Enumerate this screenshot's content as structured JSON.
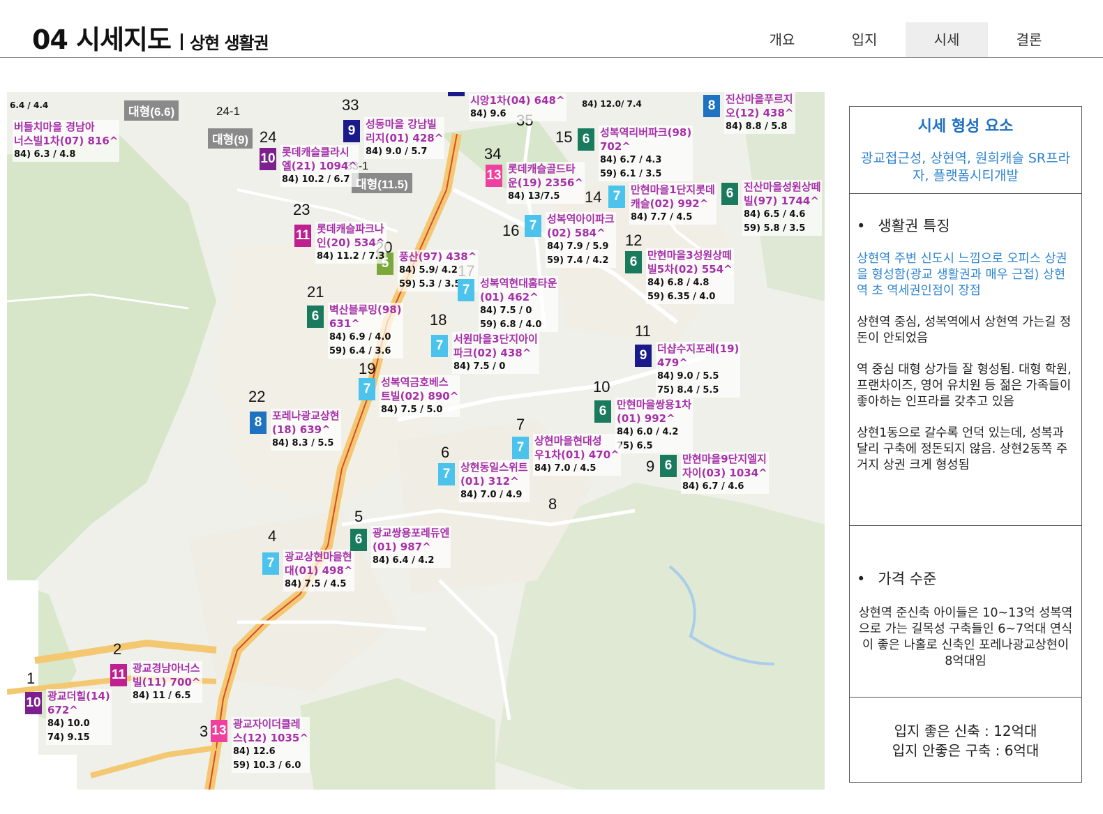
{
  "header": {
    "title": "04 시세지도",
    "subtitle": "상현 생활권",
    "tabs": [
      "개요",
      "입지",
      "시세",
      "결론"
    ],
    "active_tab": "시세"
  },
  "map": {
    "complexes": [
      {
        "badge": "10",
        "color": "#7c1f8f",
        "name1": "광교더힐(14)",
        "name2": "672^",
        "price1": "84) 10.0",
        "price2": "74) 9.15"
      },
      {
        "badge": "11",
        "color": "#c01f8f",
        "name1": "광교경남아너스",
        "name2": "빌(11) 700^",
        "price1": "84) 11 / 6.5",
        "price2": ""
      },
      {
        "badge": "13",
        "color": "#ef3f9f",
        "name1": "광교자이더클레",
        "name2": "스(12) 1035^",
        "price1": "84) 12.6",
        "price2": "59) 10.3 / 6.0"
      },
      {
        "badge": "7",
        "color": "#4cc3ec",
        "name1": "광교상현마을현",
        "name2": "대(01) 498^",
        "price1": "84) 7.5 / 4.5",
        "price2": ""
      },
      {
        "badge": "6",
        "color": "#1a7a5e",
        "name1": "광교쌍용포레듀엔",
        "name2": "(01) 987^",
        "price1": "84) 6.4 / 4.2",
        "price2": ""
      },
      {
        "badge": "7",
        "color": "#4cc3ec",
        "name1": "상현동일스위트",
        "name2": "(01) 312^",
        "price1": "84) 7.0 / 4.9",
        "price2": ""
      },
      {
        "badge": "8",
        "color": "#1d73c2",
        "name1": "포레나광교상현",
        "name2": "(18) 639^",
        "price1": "84) 8.3 / 5.5",
        "price2": ""
      },
      {
        "badge": "7",
        "color": "#4cc3ec",
        "name1": "성복역금호베스",
        "name2": "트빌(02) 890^",
        "price1": "84) 7.5 / 5.0",
        "price2": ""
      },
      {
        "badge": "7",
        "color": "#4cc3ec",
        "name1": "서원마을3단지아이",
        "name2": "파크(02) 438^",
        "price1": "84) 7.5 / 0",
        "price2": ""
      },
      {
        "badge": "6",
        "color": "#1a7a5e",
        "name1": "벽산블루밍(98)",
        "name2": "631^",
        "price1": "84) 6.9 / 4.0",
        "price2": "59) 6.4 / 3.6"
      },
      {
        "badge": "5",
        "color": "#7aa83a",
        "name1": "풍산(97) 438^",
        "name2": "",
        "price1": "84) 5.9/ 4.2",
        "price2": "59) 5.3 / 3.5"
      },
      {
        "badge": "11",
        "color": "#c01f8f",
        "name1": "롯데캐슬파크나",
        "name2": "인(20) 534^",
        "price1": "84) 11.2 / 7.3",
        "price2": ""
      },
      {
        "badge": "10",
        "color": "#7c1f8f",
        "name1": "롯데캐슬클라시",
        "name2": "엘(21) 1094^",
        "price1": "84) 10.2 / 6.7",
        "price2": ""
      },
      {
        "badge": "9",
        "color": "#1a1a8a",
        "name1": "성동마을 강남빌",
        "name2": "리지(01) 428^",
        "price1": "84) 9.0 / 5.7",
        "price2": ""
      },
      {
        "badge": "13",
        "color": "#ef3f9f",
        "name1": "롯데캐슬골드타",
        "name2": "운(19) 2356^",
        "price1": "84) 13/7.5",
        "price2": ""
      },
      {
        "badge": "7",
        "color": "#4cc3ec",
        "name1": "성복역아이파크",
        "name2": "(02) 584^",
        "price1": "84) 7.9 / 5.9",
        "price2": "59) 7.4 / 4.2"
      },
      {
        "badge": "7",
        "color": "#4cc3ec",
        "name1": "성복역현대홈타운",
        "name2": "(01) 462^",
        "price1": "84) 7.5 / 0",
        "price2": "59) 6.8 / 4.0"
      },
      {
        "badge": "6",
        "color": "#1a7a5e",
        "name1": "성복역리버파크(98)",
        "name2": "702^",
        "price1": "84) 6.7 / 4.3",
        "price2": "59) 6.1 / 3.5"
      },
      {
        "badge": "7",
        "color": "#4cc3ec",
        "name1": "만현마을1단지롯데",
        "name2": "캐슬(02) 992^",
        "price1": "84) 7.7 / 4.5",
        "price2": ""
      },
      {
        "badge": "6",
        "color": "#1a7a5e",
        "name1": "만현마을3성원상떼",
        "name2": "빌5차(02) 554^",
        "price1": "84) 6.8 / 4.8",
        "price2": "59) 6.35 / 4.0"
      },
      {
        "badge": "6",
        "color": "#1a7a5e",
        "name1": "진산마을성원상떼",
        "name2": "빌(97) 1744^",
        "price1": "84) 6.5 / 4.6",
        "price2": "59) 5.8 / 3.5"
      },
      {
        "badge": "8",
        "color": "#1d73c2",
        "name1": "진산마을푸르지",
        "name2": "오(12) 438^",
        "price1": "84) 8.8 / 5.8",
        "price2": ""
      },
      {
        "badge": "9",
        "color": "#1a1a8a",
        "name1": "더샵수지포레(19)",
        "name2": "479^",
        "price1": "84) 9.0 / 5.5",
        "price2": "75) 8.4 / 5.5"
      },
      {
        "badge": "6",
        "color": "#1a7a5e",
        "name1": "만현마을쌍용1차",
        "name2": "(01) 992^",
        "price1": "84) 6.0 / 4.2",
        "price2": "75) 6.5"
      },
      {
        "badge": "7",
        "color": "#4cc3ec",
        "name1": "상현마을현대성",
        "name2": "우1차(01) 470^",
        "price1": "84) 7.0 / 4.5",
        "price2": ""
      },
      {
        "badge": "6",
        "color": "#1a7a5e",
        "name1": "만현마을9단지엘지",
        "name2": "자이(03) 1034^",
        "price1": "84) 6.7 / 4.6",
        "price2": ""
      },
      {
        "badge": "",
        "color": "#1a1a8a",
        "name1": "시앙1차(04) 648^",
        "name2": "",
        "price1": "84) 9.6",
        "price2": ""
      },
      {
        "badge": "",
        "color": "#a62fa9",
        "name1": "버들치마을 경남아",
        "name2": "너스빌1차(07) 816^",
        "price1": "84) 6.3 / 4.8",
        "price2": ""
      }
    ],
    "numbers": [
      "1",
      "2",
      "3",
      "4",
      "5",
      "6",
      "7",
      "8",
      "9",
      "10",
      "11",
      "12",
      "14",
      "15",
      "16",
      "17",
      "18",
      "19",
      "20",
      "21",
      "22",
      "23",
      "24",
      "24-1",
      "33",
      "33-1",
      "34",
      "35"
    ],
    "gray_tags": [
      "대형(6.6)",
      "대형(9)",
      "대형(11.5)"
    ],
    "edge_text": [
      "6.4 / 4.4",
      "84) 12.0/ 7.4"
    ]
  },
  "side": {
    "title": "시세 형성 요소",
    "subtitle": "광교접근성, 상현역, 원희캐슬 SR프라자, 플랫폼시티개발",
    "sec1_heading": "생활권 특징",
    "sec1_blue": "상현역 주변 신도시 느낌으로 오피스 상권을 형성함(광교 생활권과 매우 근접) 상현역 초 역세권인점이 장점",
    "sec1_p1": "상현역 중심, 성복역에서 상현역 가는길 정돈이 안되었음",
    "sec1_p2": "역 중심 대형 상가들 잘 형성됨. 대형 학원, 프랜차이즈, 영어 유치원 등 젊은 가족들이 좋아하는 인프라를 갖추고 있음",
    "sec1_p3": "상현1동으로 갈수록 언덕 있는데, 성복과 달리 구축에 정돈되지 않음. 상현2동쪽 주거지 상권 크게 형성됨",
    "sec2_heading": "가격 수준",
    "sec2_p": "상현역 준신축 아이들은 10~13억 성복역으로 가는 길목성 구축들인 6~7억대 연식이 좋은 나홀로 신축인 포레나광교상현이 8억대임",
    "conclusion1": "입지 좋은 신축 : 12억대",
    "conclusion2": "입지 안좋은 구축 : 6억대"
  }
}
